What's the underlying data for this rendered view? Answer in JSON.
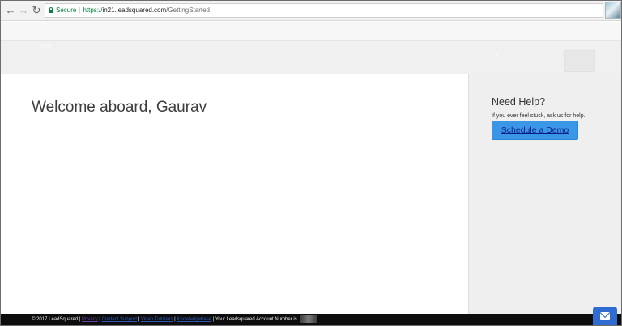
{
  "browser": {
    "secure_label": "Secure",
    "url_scheme": "https://",
    "url_host": "in21.leadsquared.com",
    "url_path": "/GettingStarted"
  },
  "navbar": {
    "menu_label": "Menu",
    "close_glyph": "×"
  },
  "main": {
    "welcome": "Welcome aboard, Gaurav"
  },
  "help": {
    "title": "Need Help?",
    "text": "If you ever feel stuck, ask us for help.",
    "demo_button": "Schedule a Demo"
  },
  "footer": {
    "copyright": "© 2017 LeadSquared |",
    "link1": "Privacy",
    "link2": "Contact Support",
    "link3": "Video Tutorials",
    "link4": "Knowledgebase",
    "account_text": "| Your Leadsquared Account Number is"
  },
  "colors": {
    "button": "#3a97e8",
    "secure": "#0b8043",
    "footer": "#0d0d0d",
    "chat": "#2f6bd0"
  },
  "icons": [
    "back-arrow-icon",
    "forward-arrow-icon",
    "reload-icon",
    "lock-icon",
    "extension-icon",
    "mail-icon"
  ]
}
